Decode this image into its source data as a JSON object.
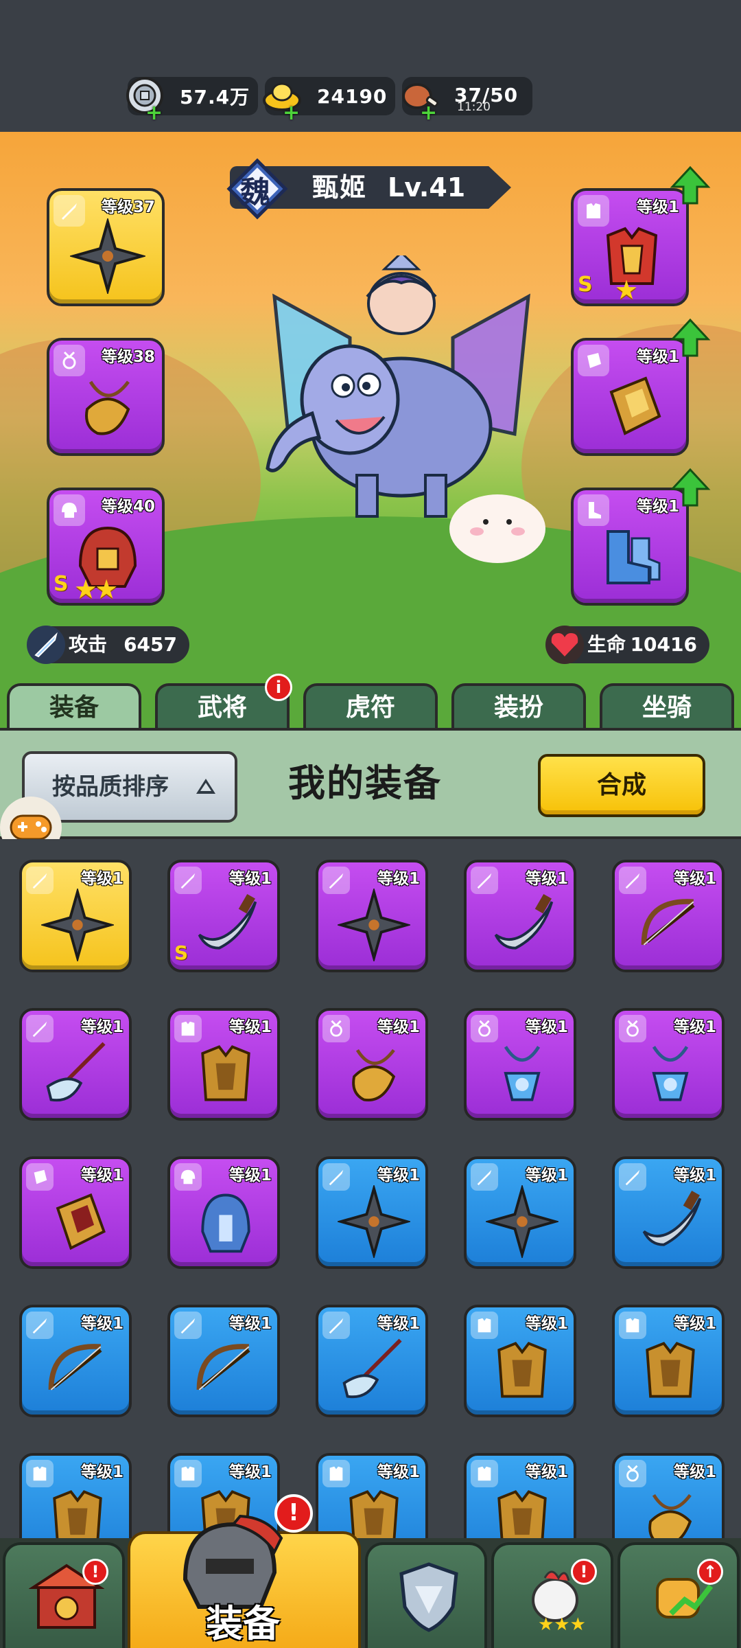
{
  "resources": [
    {
      "name": "silver-coin",
      "value": "57.4万",
      "sub": ""
    },
    {
      "name": "gold-ingot",
      "value": "24190",
      "sub": ""
    },
    {
      "name": "meat-stamina",
      "value": "37/50",
      "sub": "11:20"
    }
  ],
  "hero": {
    "kingdom": "魏",
    "name": "甄姬",
    "level": "Lv.41"
  },
  "equipped_left": [
    {
      "level": "等级37",
      "rarity": "gold",
      "item": "shuriken-icon"
    },
    {
      "level": "等级38",
      "rarity": "purple",
      "item": "amulet-icon"
    },
    {
      "level": "等级40",
      "rarity": "purple",
      "item": "helmet-icon",
      "grade": "S",
      "stars": "★★"
    }
  ],
  "equipped_right": [
    {
      "level": "等级1",
      "rarity": "purple",
      "item": "armor-icon",
      "grade": "S",
      "stars": "★"
    },
    {
      "level": "等级1",
      "rarity": "purple",
      "item": "bracer-icon"
    },
    {
      "level": "等级1",
      "rarity": "purple",
      "item": "boots-icon"
    }
  ],
  "stats": {
    "attack_label": "攻击",
    "attack_value": "6457",
    "hp_label": "生命",
    "hp_value": "10416"
  },
  "tabs": [
    {
      "label": "装备",
      "active": true,
      "badge": ""
    },
    {
      "label": "武将",
      "active": false,
      "badge": "i"
    },
    {
      "label": "虎符",
      "active": false,
      "badge": ""
    },
    {
      "label": "装扮",
      "active": false,
      "badge": ""
    },
    {
      "label": "坐骑",
      "active": false,
      "badge": ""
    }
  ],
  "panel": {
    "sort_label": "按品质排序",
    "title": "我的装备",
    "merge_label": "合成"
  },
  "inventory": [
    {
      "level": "等级1",
      "rarity": "gold",
      "item": "shuriken-icon"
    },
    {
      "level": "等级1",
      "rarity": "purple",
      "item": "scimitar-icon",
      "grade": "S"
    },
    {
      "level": "等级1",
      "rarity": "purple",
      "item": "shuriken-icon"
    },
    {
      "level": "等级1",
      "rarity": "purple",
      "item": "scimitar-icon"
    },
    {
      "level": "等级1",
      "rarity": "purple",
      "item": "crossbow-icon"
    },
    {
      "level": "等级1",
      "rarity": "purple",
      "item": "glaive-icon"
    },
    {
      "level": "等级1",
      "rarity": "purple",
      "item": "armor-icon"
    },
    {
      "level": "等级1",
      "rarity": "purple",
      "item": "amulet-icon"
    },
    {
      "level": "等级1",
      "rarity": "purple",
      "item": "pendant-icon"
    },
    {
      "level": "等级1",
      "rarity": "purple",
      "item": "pendant-icon"
    },
    {
      "level": "等级1",
      "rarity": "purple",
      "item": "bracer-icon"
    },
    {
      "level": "等级1",
      "rarity": "purple",
      "item": "helmet-icon"
    },
    {
      "level": "等级1",
      "rarity": "blue",
      "item": "shuriken-icon"
    },
    {
      "level": "等级1",
      "rarity": "blue",
      "item": "shuriken-icon"
    },
    {
      "level": "等级1",
      "rarity": "blue",
      "item": "scimitar-icon"
    },
    {
      "level": "等级1",
      "rarity": "blue",
      "item": "crossbow-icon"
    },
    {
      "level": "等级1",
      "rarity": "blue",
      "item": "crossbow-icon"
    },
    {
      "level": "等级1",
      "rarity": "blue",
      "item": "glaive-icon"
    },
    {
      "level": "等级1",
      "rarity": "blue",
      "item": "armor-icon"
    },
    {
      "level": "等级1",
      "rarity": "blue",
      "item": "armor-icon"
    },
    {
      "level": "等级1",
      "rarity": "blue",
      "item": "armor-icon"
    },
    {
      "level": "等级1",
      "rarity": "blue",
      "item": "armor-icon"
    },
    {
      "level": "等级1",
      "rarity": "blue",
      "item": "armor-icon"
    },
    {
      "level": "等级1",
      "rarity": "blue",
      "item": "armor-icon"
    },
    {
      "level": "等级1",
      "rarity": "blue",
      "item": "amulet-icon"
    }
  ],
  "bottom_nav": [
    {
      "name": "nav-gate",
      "icon": "gate-icon",
      "badge": "!",
      "active": false
    },
    {
      "name": "nav-equipment",
      "icon": "helmet-icon",
      "label": "装备",
      "badge": "!",
      "active": true
    },
    {
      "name": "nav-shield",
      "icon": "shield-icon",
      "badge": "",
      "active": false
    },
    {
      "name": "nav-rooster",
      "icon": "rooster-icon",
      "badge": "!",
      "active": false
    },
    {
      "name": "nav-upgrade",
      "icon": "fist-upgrade-icon",
      "badge": "↑",
      "active": false
    }
  ],
  "colors": {
    "gold": "#f5c31c",
    "purple": "#9b2ed6",
    "blue": "#1d7fd8",
    "tab_active": "#9cc9a2",
    "tab_inactive": "#3c6b4e",
    "merge_button": "#f7c107"
  }
}
